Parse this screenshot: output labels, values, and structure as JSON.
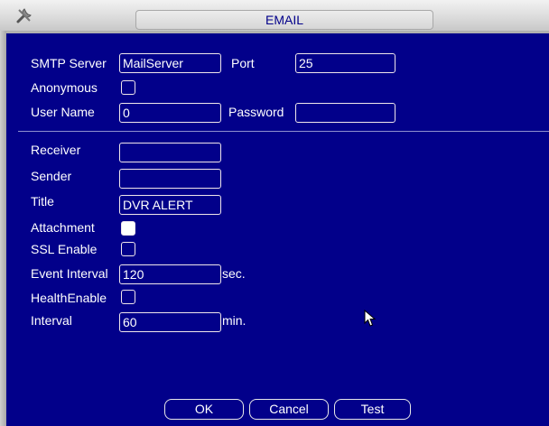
{
  "window": {
    "title": "EMAIL"
  },
  "icons": {
    "app": "tools-icon",
    "cursor": "mouse-pointer-icon"
  },
  "colors": {
    "background": "#02008a",
    "text": "#ffffff",
    "border": "#f0e6ea"
  },
  "smtp": {
    "server_label": "SMTP Server",
    "server_value": "MailServer",
    "port_label": "Port",
    "port_value": "25"
  },
  "anonymous": {
    "label": "Anonymous",
    "checked": false
  },
  "user": {
    "username_label": "User Name",
    "username_value": "0",
    "password_label": "Password",
    "password_value": ""
  },
  "receiver": {
    "label": "Receiver",
    "value": ""
  },
  "sender": {
    "label": "Sender",
    "value": ""
  },
  "subject": {
    "label": "Title",
    "value": "DVR ALERT"
  },
  "attachment": {
    "label": "Attachment",
    "checked": true
  },
  "ssl": {
    "label": "SSL Enable",
    "checked": false
  },
  "event_interval": {
    "label": "Event Interval",
    "value": "120",
    "unit": "sec."
  },
  "health": {
    "label": "HealthEnable",
    "checked": false
  },
  "interval": {
    "label": "Interval",
    "value": "60",
    "unit": "min."
  },
  "buttons": {
    "ok": "OK",
    "cancel": "Cancel",
    "test": "Test"
  }
}
